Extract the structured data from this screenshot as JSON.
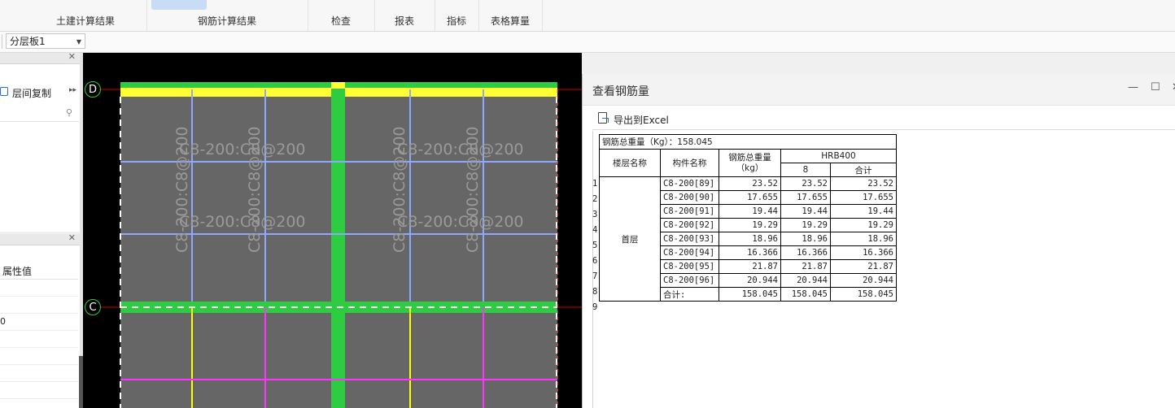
{
  "ribbon": {
    "groups": [
      "土建计算结果",
      "钢筋计算结果",
      "检查",
      "报表",
      "指标",
      "表格算量"
    ]
  },
  "toolbar": {
    "floor_selector": "分层板1"
  },
  "left_panel": {
    "copy_label": "层间复制",
    "prop_header": "属性值",
    "prop_values": [
      "",
      "",
      "0",
      "",
      "",
      "",
      ""
    ]
  },
  "canvas": {
    "axis_labels": [
      "D",
      "C"
    ],
    "slab_labels": [
      "C8-200:C8@200",
      "C8-200:C8@200",
      "C8-200:C8@200",
      "C8-200:C8@200"
    ],
    "vertical_slab_labels": [
      "C8-200:C8@200",
      "C8-200:C8@200",
      "C8-200:C8@200",
      "C8-200:C8@200"
    ]
  },
  "dialog": {
    "title": "查看钢筋量",
    "minimize": "—",
    "maximize": "☐",
    "close": "✕",
    "export_label": "导出到Excel",
    "table": {
      "total_label": "钢筋总重量（Kg）：158.045",
      "col_floor": "楼层名称",
      "col_member": "构件名称",
      "col_total_weight": "钢筋总重量（kg）",
      "col_grade": "HRB400",
      "col_dia": "8",
      "col_sum": "合计",
      "floor_name": "首层",
      "rows": [
        {
          "n": "1",
          "member": "C8-200[89]",
          "total": "23.52",
          "d8": "23.52",
          "sum": "23.52"
        },
        {
          "n": "2",
          "member": "C8-200[90]",
          "total": "17.655",
          "d8": "17.655",
          "sum": "17.655"
        },
        {
          "n": "3",
          "member": "C8-200[91]",
          "total": "19.44",
          "d8": "19.44",
          "sum": "19.44"
        },
        {
          "n": "4",
          "member": "C8-200[92]",
          "total": "19.29",
          "d8": "19.29",
          "sum": "19.29"
        },
        {
          "n": "5",
          "member": "C8-200[93]",
          "total": "18.96",
          "d8": "18.96",
          "sum": "18.96"
        },
        {
          "n": "6",
          "member": "C8-200[94]",
          "total": "16.366",
          "d8": "16.366",
          "sum": "16.366"
        },
        {
          "n": "7",
          "member": "C8-200[95]",
          "total": "21.87",
          "d8": "21.87",
          "sum": "21.87"
        },
        {
          "n": "8",
          "member": "C8-200[96]",
          "total": "20.944",
          "d8": "20.944",
          "sum": "20.944"
        }
      ],
      "sum_row": {
        "n": "9",
        "label": "合计:",
        "total": "158.045",
        "d8": "158.045",
        "sum": "158.045"
      }
    }
  },
  "colors": {
    "slab_fill": "#666666",
    "beam_green": "#2ecc40",
    "beam_yellow": "#ffff33",
    "rebar_blue": "#8fa8ff",
    "rebar_magenta": "#ff33ff",
    "rebar_yellow": "#ffff00"
  }
}
